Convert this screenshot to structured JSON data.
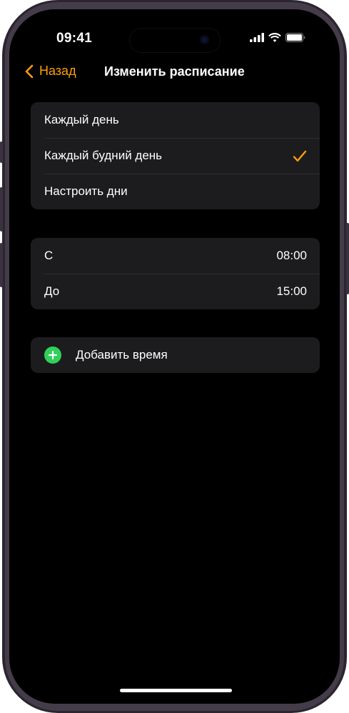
{
  "status_bar": {
    "time": "09:41"
  },
  "nav": {
    "back_label": "Назад",
    "title": "Изменить расписание"
  },
  "days_group": {
    "items": [
      {
        "label": "Каждый день",
        "selected": false
      },
      {
        "label": "Каждый будний день",
        "selected": true
      },
      {
        "label": "Настроить дни",
        "selected": false
      }
    ]
  },
  "time_group": {
    "from_label": "С",
    "from_value": "08:00",
    "to_label": "До",
    "to_value": "15:00"
  },
  "add_time": {
    "label": "Добавить время"
  },
  "colors": {
    "accent": "#ff9f0a",
    "add_icon": "#30d158",
    "cell_background": "#1c1c1e"
  }
}
